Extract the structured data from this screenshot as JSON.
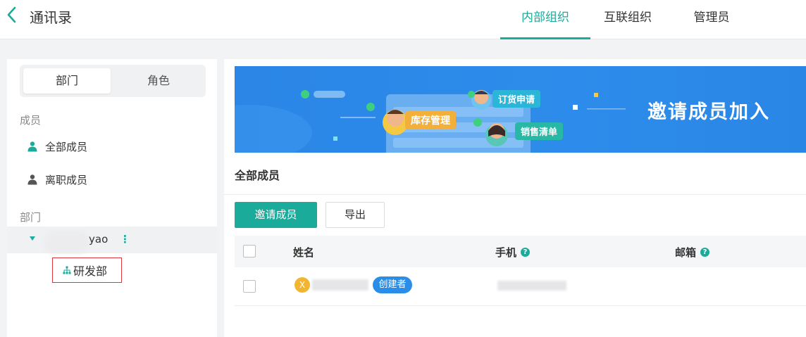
{
  "header": {
    "title": "通讯录",
    "tabs": [
      "内部组织",
      "互联组织",
      "管理员"
    ],
    "active_tab": "内部组织"
  },
  "sidebar": {
    "segment": [
      "部门",
      "角色"
    ],
    "members_label": "成员",
    "members": [
      "全部成员",
      "离职成员"
    ],
    "dept_label": "部门",
    "org_name_suffix": "yao",
    "sub_dept": "研发部"
  },
  "banner": {
    "headline": "邀请成员加入",
    "bubbles": [
      "订货申请",
      "库存管理",
      "销售清单"
    ]
  },
  "main": {
    "section_title": "全部成员",
    "invite_button": "邀请成员",
    "export_button": "导出",
    "columns": [
      "姓名",
      "手机",
      "邮箱"
    ],
    "row": {
      "avatar_letter": "X",
      "role_badge": "创建者"
    }
  },
  "colors": {
    "accent": "#1aab9b",
    "banner_blue": "#2b86e6",
    "badge_blue": "#2a8ee8",
    "avatar_yellow": "#f2b531",
    "highlight_red": "#d9363e"
  }
}
